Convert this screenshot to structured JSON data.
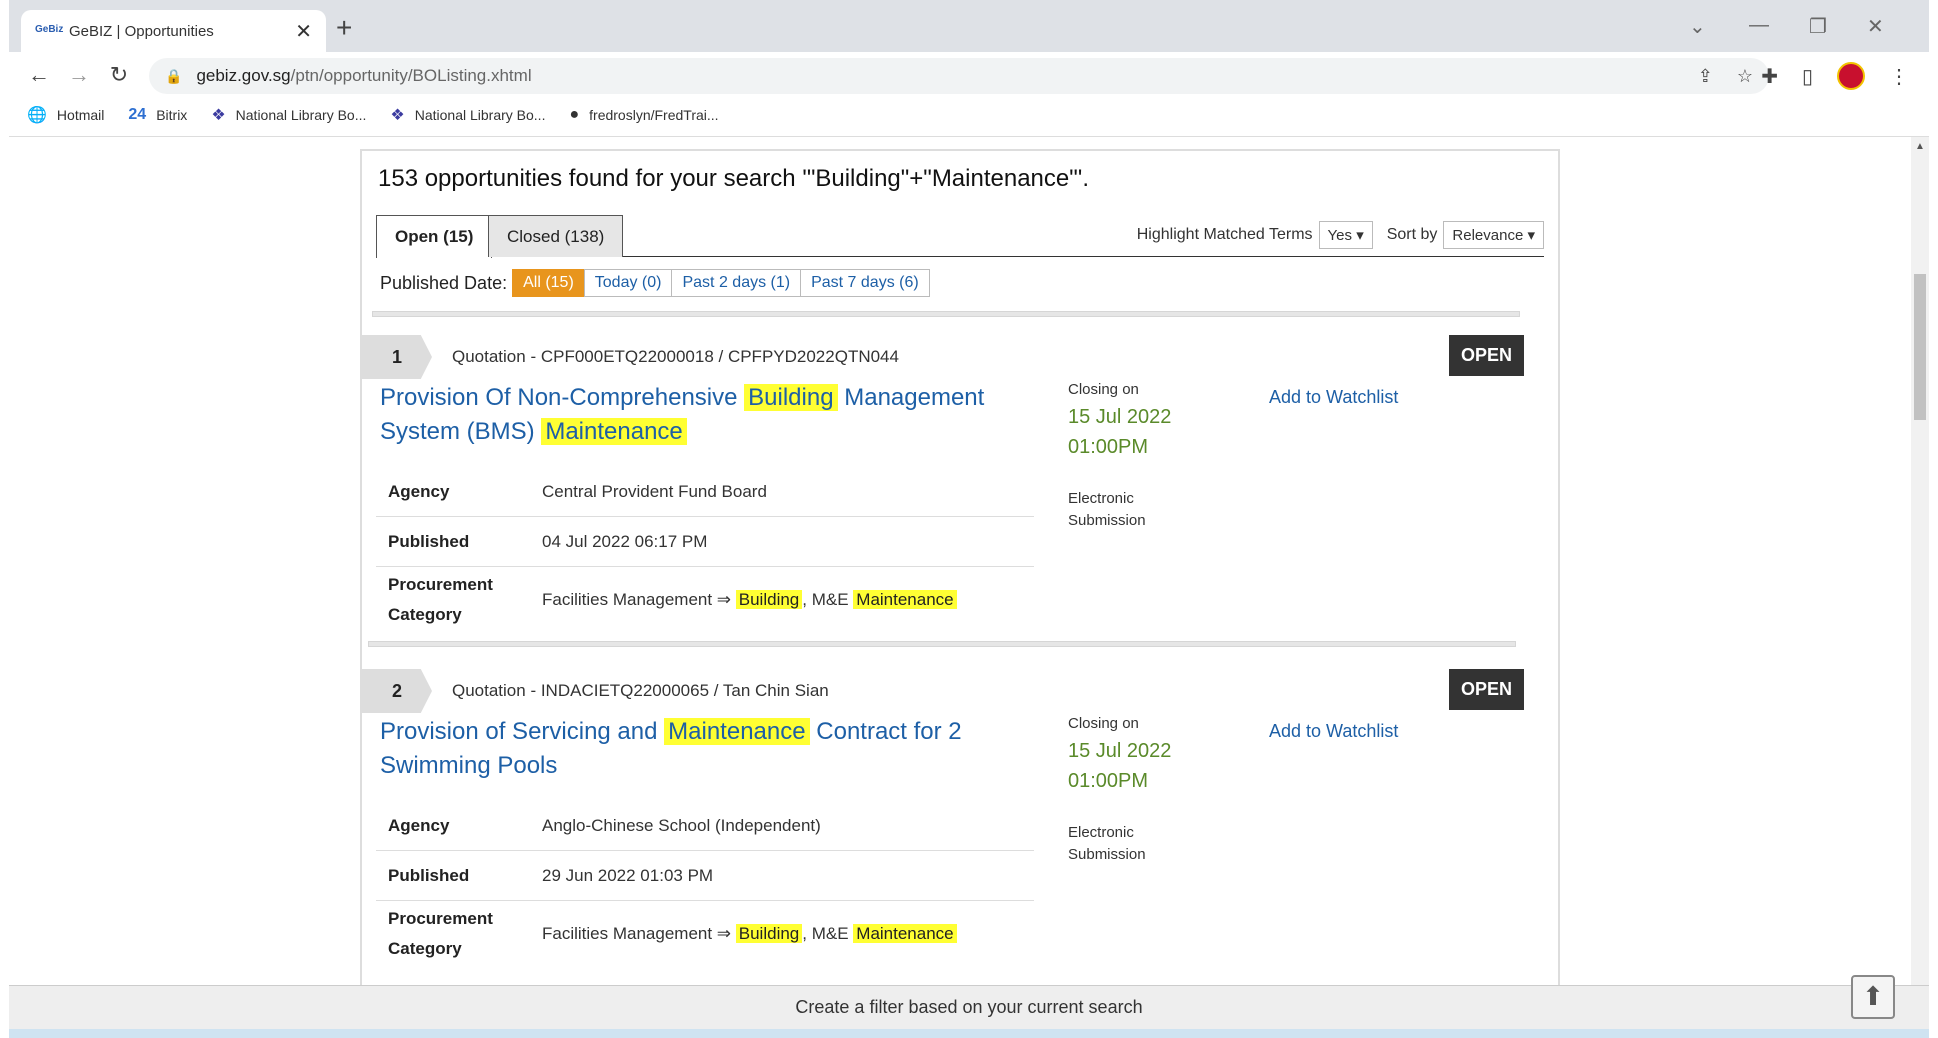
{
  "browser": {
    "tab_title": "GeBIZ | Opportunities",
    "url_host": "gebiz.gov.sg",
    "url_path": "/ptn/opportunity/BOListing.xhtml",
    "bookmarks": [
      "Hotmail",
      "Bitrix",
      "National Library Bo...",
      "National Library Bo...",
      "fredroslyn/FredTrai..."
    ],
    "bookmark_icons": [
      "globe-icon",
      "bitrix-icon",
      "library-icon",
      "library-icon",
      "github-icon"
    ],
    "bitrix_prefix": "24"
  },
  "search": {
    "headline": "153 opportunities found for your search '\"Building\"+\"Maintenance\"'.",
    "tabs": [
      "Open (15)",
      "Closed (138)"
    ],
    "highlight_label": "Highlight Matched Terms",
    "highlight_value": "Yes",
    "sort_label": "Sort by",
    "sort_value": "Relevance",
    "published_label": "Published Date:",
    "published_filters": [
      "All (15)",
      "Today (0)",
      "Past 2 days (1)",
      "Past 7 days (6)"
    ]
  },
  "items": [
    {
      "number": "1",
      "ref": "Quotation - CPF000ETQ22000018 / CPFPYD2022QTN044",
      "status": "OPEN",
      "title_parts": [
        "Provision Of Non-Comprehensive ",
        "Building",
        " Management System (BMS) ",
        "Maintenance"
      ],
      "agency_label": "Agency",
      "agency": "Central Provident Fund Board",
      "published_label": "Published",
      "published": "04 Jul 2022 06:17 PM",
      "category_label": "Procurement Category",
      "category_parts": [
        "Facilities Management ⇒ ",
        "Building",
        ", M&E ",
        "Maintenance"
      ],
      "closing_label": "Closing on",
      "closing_date": "15 Jul 2022",
      "closing_time": "01:00PM",
      "submission": "Electronic Submission",
      "watchlist": "Add to Watchlist"
    },
    {
      "number": "2",
      "ref": "Quotation - INDACIETQ22000065 / Tan Chin Sian",
      "status": "OPEN",
      "title_parts": [
        "Provision of Servicing and ",
        "Maintenance",
        " Contract for 2 Swimming Pools"
      ],
      "agency_label": "Agency",
      "agency": "Anglo-Chinese School (Independent)",
      "published_label": "Published",
      "published": "29 Jun 2022 01:03 PM",
      "category_label": "Procurement Category",
      "category_parts": [
        "Facilities Management ⇒ ",
        "Building",
        ", M&E ",
        "Maintenance"
      ],
      "closing_label": "Closing on",
      "closing_date": "15 Jul 2022",
      "closing_time": "01:00PM",
      "submission": "Electronic Submission",
      "watchlist": "Add to Watchlist"
    }
  ],
  "footer": {
    "filter_text": "Create a filter based on your current search"
  }
}
